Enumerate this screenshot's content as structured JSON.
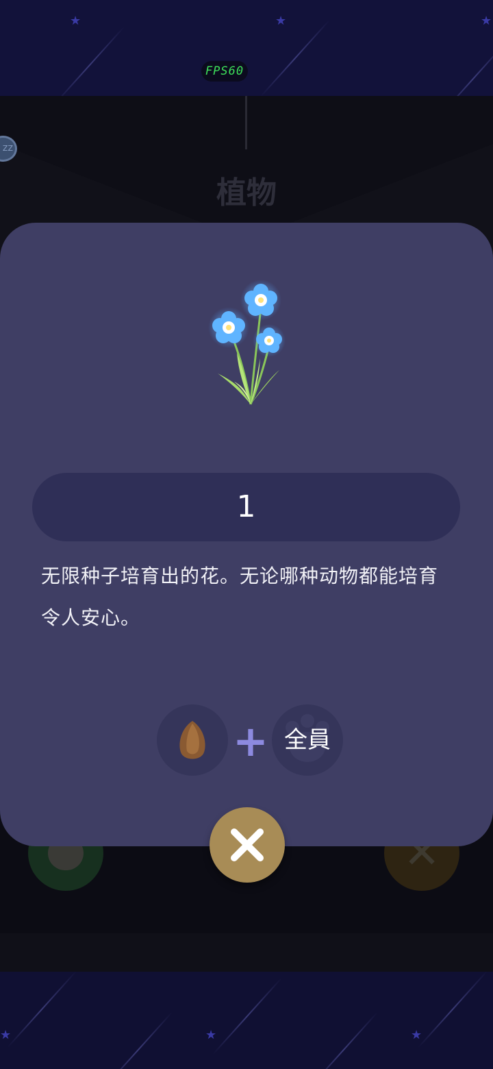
{
  "hud": {
    "fps_label": "FPS60"
  },
  "scene": {
    "title": "植物",
    "badge_text": "ZZ"
  },
  "dialog": {
    "count": "1",
    "description_line1": "无限种子培育出的花。无论哪种动物都能培育",
    "description_line2": "令人安心。",
    "recipe": {
      "ingredient_icon": "seed-icon",
      "operator": "+",
      "target_label": "全員",
      "target_icon": "paw-icon"
    },
    "close_icon": "close-icon"
  },
  "colors": {
    "dialog_bg": "#3f3e64",
    "count_bar_bg": "#2f2f57",
    "close_button": "#a88c56",
    "fps_text": "#3ee05a",
    "flower_blue": "#5fb4ff"
  }
}
